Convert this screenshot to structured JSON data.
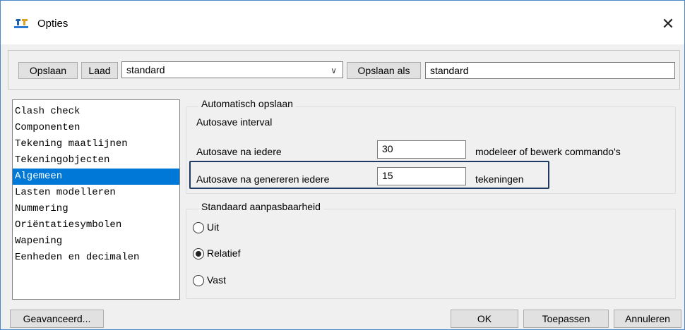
{
  "window": {
    "title": "Opties",
    "close_glyph": "✕"
  },
  "toolbar": {
    "save_label": "Opslaan",
    "load_label": "Laad",
    "preset_value": "standard",
    "save_as_label": "Opslaan als",
    "save_as_value": "standard"
  },
  "categories": [
    "Clash check",
    "Componenten",
    "Tekening maatlijnen",
    "Tekeningobjecten",
    "Algemeen",
    "Lasten modelleren",
    "Nummering",
    "Oriëntatiesymbolen",
    "Wapening",
    "Eenheden en decimalen"
  ],
  "selected_category": "Algemeen",
  "autosave": {
    "group_title": "Automatisch opslaan",
    "interval_label": "Autosave interval",
    "after_commands_label": "Autosave na iedere",
    "after_commands_value": "30",
    "after_commands_unit": "modeleer of bewerk commando's",
    "after_drawings_label": "Autosave na genereren iedere",
    "after_drawings_value": "15",
    "after_drawings_unit": "tekeningen"
  },
  "adaptivity": {
    "group_title": "Standaard aanpasbaarheid",
    "options": [
      "Uit",
      "Relatief",
      "Vast"
    ],
    "selected": "Relatief"
  },
  "footer": {
    "advanced_label": "Geavanceerd...",
    "ok_label": "OK",
    "apply_label": "Toepassen",
    "cancel_label": "Annuleren"
  },
  "colors": {
    "selection": "#0078d7",
    "highlight_border": "#1f3a62",
    "window_border": "#4a88c7"
  }
}
